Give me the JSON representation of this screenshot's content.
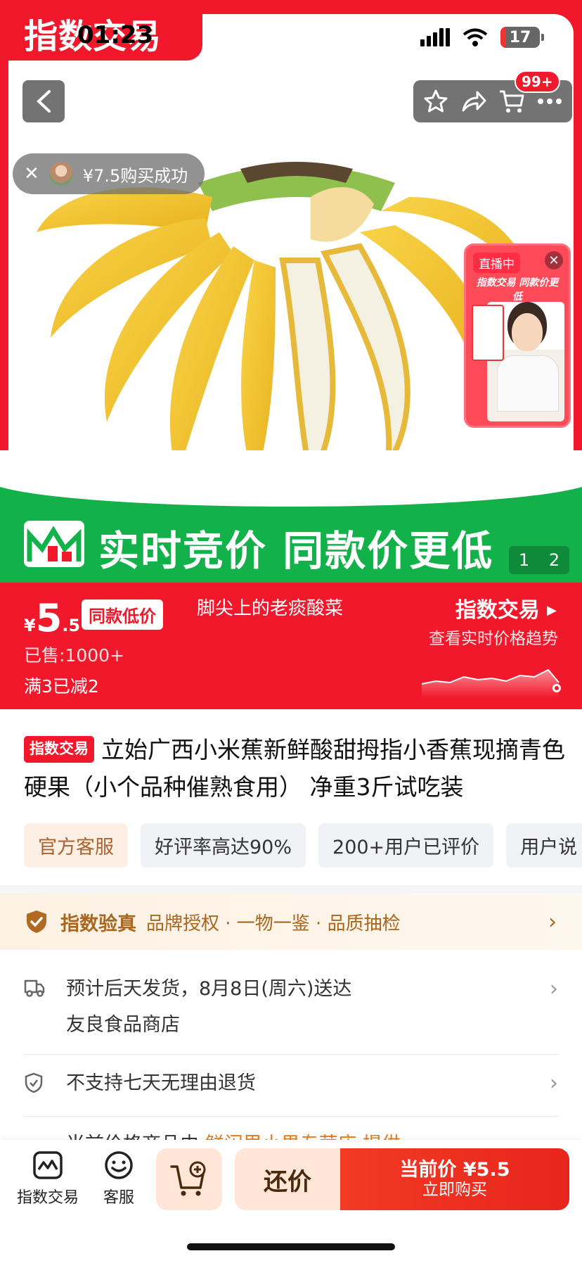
{
  "status": {
    "time": "01:23",
    "battery": "17"
  },
  "brand": {
    "name": "指数交易"
  },
  "header": {
    "cart_badge": "99+"
  },
  "toast": {
    "text": "¥7.5购买成功"
  },
  "live": {
    "label": "直播中",
    "subtitle": "指数交易 同款价更低"
  },
  "banner": {
    "text": "实时竞价 同款价更低",
    "pager_current": "1",
    "pager_total": "2"
  },
  "price": {
    "yen": "¥",
    "int": "5",
    "dec": ".5",
    "low_badge": "同款低价",
    "shop_tag": "脚尖上的老痰酸菜",
    "sold": "已售:1000+",
    "promo": "满3已减2",
    "trend_title": "指数交易",
    "trend_sub": "查看实时价格趋势"
  },
  "product": {
    "badge": "指数交易",
    "title": "立始广西小米蕉新鲜酸甜拇指小香蕉现摘青色硬果（小个品种催熟食用） 净重3斤试吃装",
    "chips": [
      "官方客服",
      "好评率高达90%",
      "200+用户已评价",
      "用户说"
    ]
  },
  "verify": {
    "title": "指数验真",
    "desc": "品牌授权 · 一物一鉴 · 品质抽检"
  },
  "shipping": {
    "line1": "预计后天发货，8月8日(周六)送达",
    "line2": "友良食品商店"
  },
  "returns": {
    "text": "不支持七天无理由退货"
  },
  "partial": {
    "text": "当前价格商品由",
    "link": "鲜闪里小果专营店 提供"
  },
  "bottom": {
    "tab_exchange": "指数交易",
    "tab_service": "客服",
    "bargain": "还价",
    "buy_top": "当前价 ¥5.5",
    "buy_bottom": "立即购买"
  },
  "colors": {
    "brand_red": "#f2182b",
    "band_green": "#12b14a",
    "verify_gold": "#a8661e"
  }
}
